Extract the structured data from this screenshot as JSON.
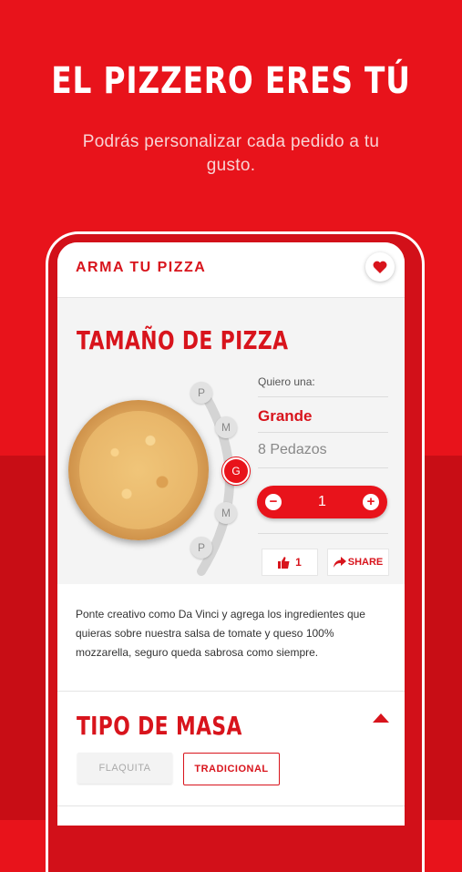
{
  "hero": {
    "title": "EL PIZZERO ERES TÚ",
    "subtitle": "Podrás personalizar cada pedido a tu gusto."
  },
  "appbar": {
    "title": "ARMA TU PIZZA",
    "favorite_icon": "heart-icon"
  },
  "size_section": {
    "title": "TAMAÑO DE PIZZA",
    "sizes": [
      "P",
      "M",
      "G",
      "M",
      "P"
    ],
    "selected_index": 2,
    "prompt": "Quiero una:",
    "selected_name": "Grande",
    "selected_desc": "8 Pedazos",
    "quantity": "1",
    "minus_label": "−",
    "plus_label": "+",
    "likes_count": "1",
    "share_label": "SHARE"
  },
  "description": "Ponte creativo como Da Vinci y agrega los ingredientes que quieras sobre nuestra salsa de tomate y queso 100% mozzarella, seguro queda sabrosa como siempre.",
  "dough_section": {
    "title": "TIPO DE MASA",
    "options": [
      "FLAQUITA",
      "TRADICIONAL"
    ],
    "selected": "TRADICIONAL"
  },
  "colors": {
    "brand_red": "#e8131b",
    "dark_red": "#c80d15"
  }
}
